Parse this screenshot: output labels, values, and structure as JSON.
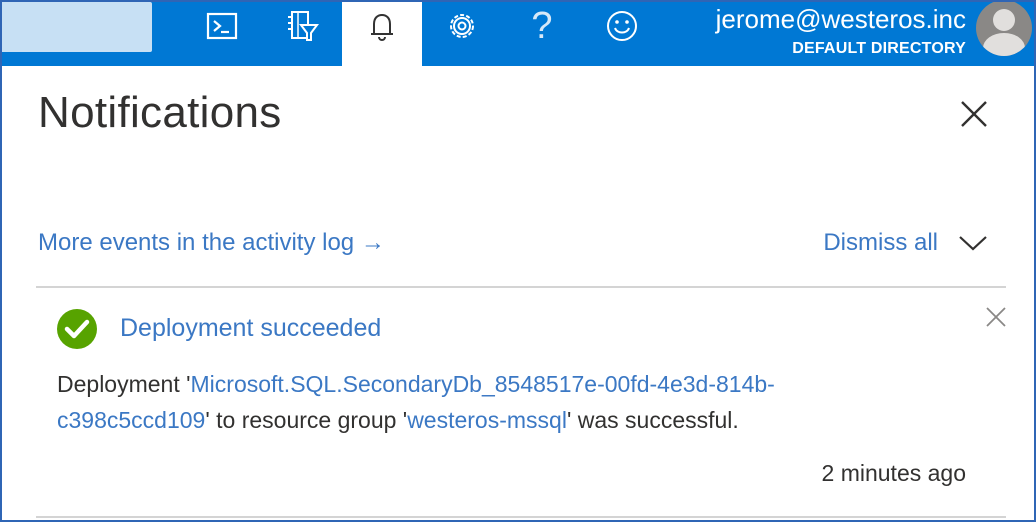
{
  "topbar": {
    "user_email": "jerome@westeros.inc",
    "user_directory": "DEFAULT DIRECTORY",
    "help_glyph": "?",
    "buttons": [
      "cloud-shell-icon",
      "directory-filter-icon",
      "bell-icon",
      "gear-icon",
      "help-icon",
      "smiley-icon"
    ],
    "active_button": "bell-icon",
    "bar_color": "#0078d4"
  },
  "panel": {
    "title": "Notifications",
    "activity_link": "More events in the activity log →",
    "dismiss_all": "Dismiss all"
  },
  "notification": {
    "status": "success",
    "status_color": "#57a300",
    "title": "Deployment succeeded",
    "body_prefix": "Deployment '",
    "deployment_name": "Microsoft.SQL.SecondaryDb_8548517e-00fd-4e3d-814b-c398c5ccd109",
    "body_middle": "' to resource group '",
    "resource_group": "westeros-mssql",
    "body_suffix": "' was successful.",
    "time": "2 minutes ago"
  },
  "colors": {
    "link": "#3b78c4",
    "text": "#323130"
  }
}
